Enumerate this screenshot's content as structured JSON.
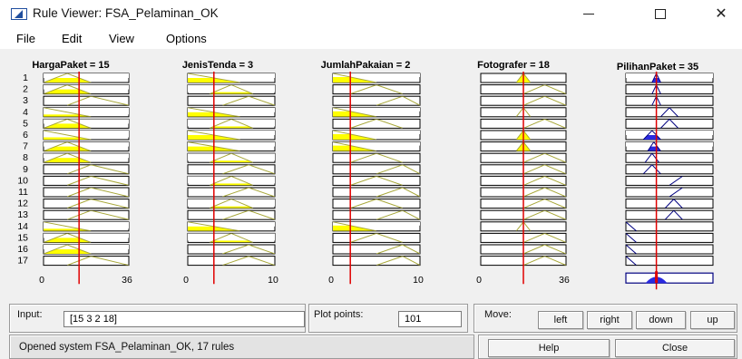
{
  "window": {
    "title": "Rule Viewer: FSA_Pelaminan_OK",
    "minimize_icon": "minimize-icon",
    "maximize_icon": "maximize-icon",
    "close_glyph": "✕"
  },
  "menu": {
    "file": "File",
    "edit": "Edit",
    "view": "View",
    "options": "Options"
  },
  "rules": [
    "1",
    "2",
    "3",
    "4",
    "5",
    "6",
    "7",
    "8",
    "9",
    "10",
    "11",
    "12",
    "13",
    "14",
    "15",
    "16",
    "17"
  ],
  "columns": [
    {
      "title": "HargaPaket = 15",
      "range": [
        0,
        36
      ],
      "tick_labels": [
        "0",
        "36"
      ],
      "input_value": 15,
      "mfs": [
        {
          "type": "tri",
          "p": [
            0,
            10,
            20
          ],
          "fill": 0.5
        },
        {
          "type": "tri",
          "p": [
            0,
            10,
            20
          ],
          "fill": 0.5
        },
        {
          "type": "tri",
          "p": [
            10,
            20,
            36
          ],
          "fill": 0
        },
        {
          "type": "trap",
          "p": [
            -14,
            -14,
            0,
            20
          ],
          "fill": 0.25
        },
        {
          "type": "tri",
          "p": [
            0,
            10,
            20
          ],
          "fill": 0.5
        },
        {
          "type": "trap",
          "p": [
            -14,
            -14,
            0,
            20
          ],
          "fill": 0.25
        },
        {
          "type": "tri",
          "p": [
            0,
            10,
            20
          ],
          "fill": 0.5
        },
        {
          "type": "tri",
          "p": [
            0,
            10,
            20
          ],
          "fill": 0.5
        },
        {
          "type": "tri",
          "p": [
            10,
            20,
            36
          ],
          "fill": 0
        },
        {
          "type": "tri",
          "p": [
            10,
            20,
            36
          ],
          "fill": 0
        },
        {
          "type": "tri",
          "p": [
            10,
            20,
            36
          ],
          "fill": 0
        },
        {
          "type": "tri",
          "p": [
            10,
            20,
            36
          ],
          "fill": 0
        },
        {
          "type": "tri",
          "p": [
            10,
            20,
            36
          ],
          "fill": 0
        },
        {
          "type": "trap",
          "p": [
            -14,
            -14,
            0,
            20
          ],
          "fill": 0.25
        },
        {
          "type": "tri",
          "p": [
            0,
            10,
            20
          ],
          "fill": 0.5
        },
        {
          "type": "tri",
          "p": [
            0,
            10,
            20
          ],
          "fill": 0.5
        },
        {
          "type": "tri",
          "p": [
            10,
            20,
            36
          ],
          "fill": 0
        }
      ]
    },
    {
      "title": "JenisTenda = 3",
      "range": [
        0,
        10
      ],
      "tick_labels": [
        "0",
        "10"
      ],
      "input_value": 3,
      "mfs": [
        {
          "type": "trap",
          "p": [
            -4,
            -4,
            0,
            6
          ],
          "fill": 0.5
        },
        {
          "type": "tri",
          "p": [
            2.5,
            5,
            7.5
          ],
          "fill": 0.2
        },
        {
          "type": "tri",
          "p": [
            4,
            7,
            10
          ],
          "fill": 0
        },
        {
          "type": "trap",
          "p": [
            -4,
            -4,
            0,
            6
          ],
          "fill": 0.5
        },
        {
          "type": "tri",
          "p": [
            2.5,
            5,
            7.5
          ],
          "fill": 0.2
        },
        {
          "type": "trap",
          "p": [
            -4,
            -4,
            0,
            6
          ],
          "fill": 0.5
        },
        {
          "type": "trap",
          "p": [
            -4,
            -4,
            0,
            6
          ],
          "fill": 0.5
        },
        {
          "type": "tri",
          "p": [
            2.5,
            5,
            7.5
          ],
          "fill": 0.2
        },
        {
          "type": "tri",
          "p": [
            4,
            7,
            10
          ],
          "fill": 0
        },
        {
          "type": "tri",
          "p": [
            2.5,
            5,
            7.5
          ],
          "fill": 0.2
        },
        {
          "type": "tri",
          "p": [
            4,
            7,
            10
          ],
          "fill": 0
        },
        {
          "type": "tri",
          "p": [
            2.5,
            5,
            7.5
          ],
          "fill": 0.2
        },
        {
          "type": "tri",
          "p": [
            4,
            7,
            10
          ],
          "fill": 0
        },
        {
          "type": "trap",
          "p": [
            -4,
            -4,
            0,
            6
          ],
          "fill": 0.5
        },
        {
          "type": "tri",
          "p": [
            2.5,
            5,
            7.5
          ],
          "fill": 0.2
        },
        {
          "type": "tri",
          "p": [
            4,
            7,
            10
          ],
          "fill": 0
        },
        {
          "type": "tri",
          "p": [
            4,
            7,
            10
          ],
          "fill": 0
        }
      ]
    },
    {
      "title": "JumlahPakaian = 2",
      "range": [
        0,
        10
      ],
      "tick_labels": [
        "0",
        "10"
      ],
      "input_value": 2,
      "mfs": [
        {
          "type": "trap",
          "p": [
            -4,
            -4,
            0,
            5
          ],
          "fill": 0.6
        },
        {
          "type": "tri",
          "p": [
            2,
            5,
            8
          ],
          "fill": 0
        },
        {
          "type": "tri",
          "p": [
            5,
            8,
            10
          ],
          "fill": 0
        },
        {
          "type": "trap",
          "p": [
            -4,
            -4,
            0,
            5
          ],
          "fill": 0.6
        },
        {
          "type": "tri",
          "p": [
            2,
            5,
            8
          ],
          "fill": 0
        },
        {
          "type": "trap",
          "p": [
            -4,
            -4,
            0,
            5
          ],
          "fill": 0.6
        },
        {
          "type": "trap",
          "p": [
            -4,
            -4,
            0,
            5
          ],
          "fill": 0.6
        },
        {
          "type": "tri",
          "p": [
            2,
            5,
            8
          ],
          "fill": 0
        },
        {
          "type": "tri",
          "p": [
            5,
            8,
            10
          ],
          "fill": 0
        },
        {
          "type": "tri",
          "p": [
            2,
            5,
            8
          ],
          "fill": 0
        },
        {
          "type": "tri",
          "p": [
            5,
            8,
            10
          ],
          "fill": 0
        },
        {
          "type": "tri",
          "p": [
            2,
            5,
            8
          ],
          "fill": 0
        },
        {
          "type": "tri",
          "p": [
            5,
            8,
            10
          ],
          "fill": 0
        },
        {
          "type": "trap",
          "p": [
            -4,
            -4,
            0,
            5
          ],
          "fill": 0.6
        },
        {
          "type": "tri",
          "p": [
            2,
            5,
            8
          ],
          "fill": 0
        },
        {
          "type": "tri",
          "p": [
            5,
            8,
            10
          ],
          "fill": 0
        },
        {
          "type": "tri",
          "p": [
            5,
            8,
            10
          ],
          "fill": 0
        }
      ]
    },
    {
      "title": "Fotografer = 18",
      "range": [
        0,
        36
      ],
      "tick_labels": [
        "0",
        "36"
      ],
      "input_value": 18,
      "mfs": [
        {
          "type": "tri",
          "p": [
            15,
            18,
            21
          ],
          "fill": 1
        },
        {
          "type": "tri",
          "p": [
            18,
            27,
            36
          ],
          "fill": 0
        },
        {
          "type": "tri",
          "p": [
            18,
            27,
            36
          ],
          "fill": 0
        },
        {
          "type": "tri",
          "p": [
            15,
            18,
            21
          ],
          "fill": 0
        },
        {
          "type": "tri",
          "p": [
            18,
            27,
            36
          ],
          "fill": 0
        },
        {
          "type": "tri",
          "p": [
            15,
            18,
            21
          ],
          "fill": 1
        },
        {
          "type": "tri",
          "p": [
            15,
            18,
            21
          ],
          "fill": 1
        },
        {
          "type": "tri",
          "p": [
            18,
            27,
            36
          ],
          "fill": 0
        },
        {
          "type": "tri",
          "p": [
            18,
            27,
            36
          ],
          "fill": 0
        },
        {
          "type": "tri",
          "p": [
            18,
            27,
            36
          ],
          "fill": 0
        },
        {
          "type": "tri",
          "p": [
            18,
            27,
            36
          ],
          "fill": 0
        },
        {
          "type": "tri",
          "p": [
            18,
            27,
            36
          ],
          "fill": 0
        },
        {
          "type": "tri",
          "p": [
            18,
            27,
            36
          ],
          "fill": 0
        },
        {
          "type": "tri",
          "p": [
            15,
            18,
            21
          ],
          "fill": 0
        },
        {
          "type": "tri",
          "p": [
            18,
            27,
            36
          ],
          "fill": 0
        },
        {
          "type": "tri",
          "p": [
            18,
            27,
            36
          ],
          "fill": 0
        },
        {
          "type": "tri",
          "p": [
            18,
            27,
            36
          ],
          "fill": 0
        }
      ]
    },
    {
      "title": "PilihanPaket = 35",
      "range": [
        0,
        100
      ],
      "tick_labels": [],
      "output_value": 35,
      "mfs": [
        {
          "type": "tri",
          "p": [
            30,
            35,
            40
          ],
          "fill": 0.5
        },
        {
          "type": "tri",
          "p": [
            30,
            35,
            40
          ],
          "fill": 0
        },
        {
          "type": "tri",
          "p": [
            30,
            35,
            40
          ],
          "fill": 0
        },
        {
          "type": "tri",
          "p": [
            40,
            50,
            60
          ],
          "fill": 0
        },
        {
          "type": "tri",
          "p": [
            40,
            50,
            60
          ],
          "fill": 0
        },
        {
          "type": "tri",
          "p": [
            20,
            30,
            40
          ],
          "fill": 0.5
        },
        {
          "type": "tri",
          "p": [
            25,
            32,
            40
          ],
          "fill": 0.5
        },
        {
          "type": "tri",
          "p": [
            22,
            30,
            38
          ],
          "fill": 0
        },
        {
          "type": "tri",
          "p": [
            20,
            30,
            40
          ],
          "fill": 0
        },
        {
          "type": "tri",
          "p": [
            50,
            65,
            85,
            0
          ],
          "fill": 0,
          "shape": "rise"
        },
        {
          "type": "tri",
          "p": [
            50,
            65,
            75
          ],
          "fill": 0,
          "shape": "rise"
        },
        {
          "type": "tri",
          "p": [
            45,
            55,
            65
          ],
          "fill": 0
        },
        {
          "type": "tri",
          "p": [
            45,
            55,
            65
          ],
          "fill": 0
        },
        {
          "type": "tri",
          "p": [
            0,
            0,
            12
          ],
          "fill": 0,
          "shape": "fall"
        },
        {
          "type": "tri",
          "p": [
            0,
            0,
            12
          ],
          "fill": 0,
          "shape": "fall"
        },
        {
          "type": "tri",
          "p": [
            0,
            0,
            12
          ],
          "fill": 0,
          "shape": "fall"
        },
        {
          "type": "tri",
          "p": [
            0,
            0,
            12
          ],
          "fill": 0,
          "shape": "fall"
        }
      ],
      "aggregate": "blue-hump"
    }
  ],
  "colors": {
    "yellow": "#ffff00",
    "olive": "#a8a83a",
    "blue": "#2a2ae0",
    "red": "#e00000",
    "navy": "#000080"
  },
  "input_label": "Input:",
  "input_value": "[15 3 2 18]",
  "plot_points_label": "Plot points:",
  "plot_points_value": "101",
  "move_label": "Move:",
  "move_buttons": {
    "left": "left",
    "right": "right",
    "down": "down",
    "up": "up"
  },
  "status_text": "Opened system FSA_Pelaminan_OK, 17 rules",
  "help_button": "Help",
  "close_button": "Close"
}
